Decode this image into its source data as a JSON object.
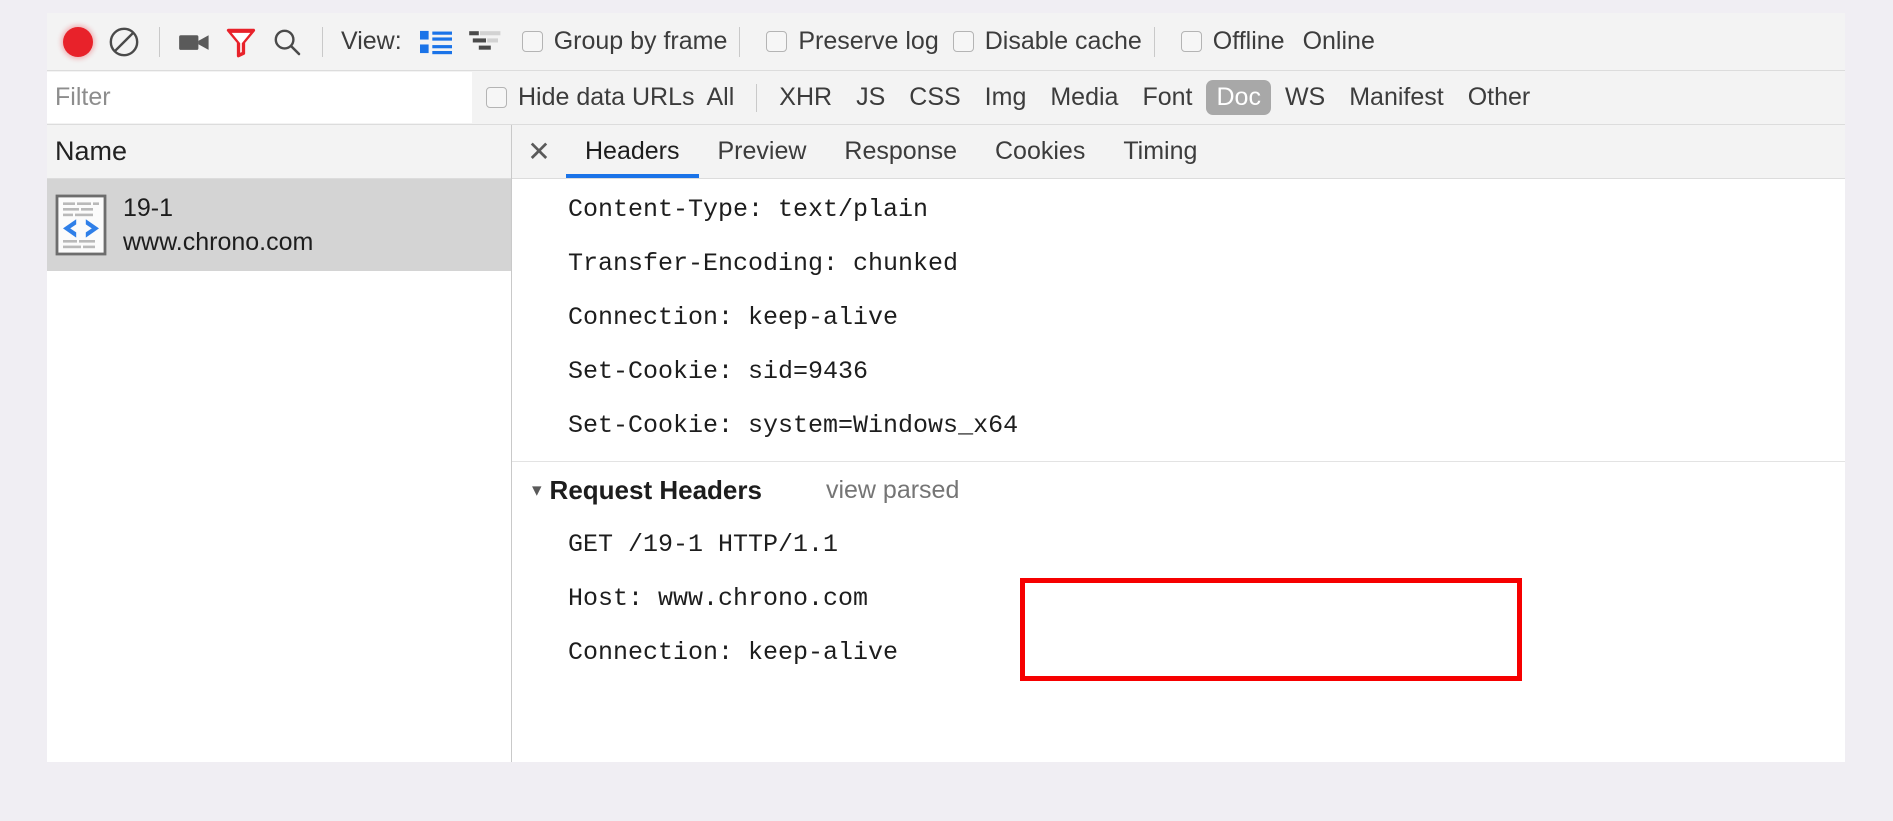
{
  "toolbar": {
    "record_icon": "record-dot-icon",
    "clear_icon": "clear-no-entry-icon",
    "camera_icon": "screenshot-camera-icon",
    "filter_icon": "filter-funnel-icon",
    "search_icon": "search-magnifier-icon",
    "view_label": "View:",
    "view_list_icon": "list-view-icon",
    "view_waterfall_icon": "waterfall-view-icon",
    "group_by_frame": "Group by frame",
    "preserve_log": "Preserve log",
    "disable_cache": "Disable cache",
    "offline": "Offline",
    "online": "Online"
  },
  "filterbar": {
    "filter_placeholder": "Filter",
    "filter_value": "",
    "hide_data_urls": "Hide data URLs",
    "types": [
      {
        "label": "All",
        "active": false
      },
      {
        "label": "XHR",
        "active": false
      },
      {
        "label": "JS",
        "active": false
      },
      {
        "label": "CSS",
        "active": false
      },
      {
        "label": "Img",
        "active": false
      },
      {
        "label": "Media",
        "active": false
      },
      {
        "label": "Font",
        "active": false
      },
      {
        "label": "Doc",
        "active": true
      },
      {
        "label": "WS",
        "active": false
      },
      {
        "label": "Manifest",
        "active": false
      },
      {
        "label": "Other",
        "active": false
      }
    ]
  },
  "left_pane": {
    "column_header": "Name",
    "rows": [
      {
        "icon": "document-code-icon",
        "name": "19-1",
        "host": "www.chrono.com",
        "selected": true
      }
    ]
  },
  "detail": {
    "close_icon": "close-icon",
    "tabs": [
      {
        "label": "Headers",
        "active": true
      },
      {
        "label": "Preview",
        "active": false
      },
      {
        "label": "Response",
        "active": false
      },
      {
        "label": "Cookies",
        "active": false
      },
      {
        "label": "Timing",
        "active": false
      }
    ],
    "response_headers": [
      "Content-Type: text/plain",
      "Transfer-Encoding: chunked",
      "Connection: keep-alive",
      "Set-Cookie: sid=9436",
      "Set-Cookie: system=Windows_x64"
    ],
    "request_headers_section": {
      "caret": "▾",
      "title": "Request Headers",
      "view_parsed": "view parsed",
      "lines": [
        "GET /19-1 HTTP/1.1",
        "Host: www.chrono.com",
        "Connection: keep-alive"
      ]
    },
    "highlight_color": "#f60000"
  }
}
